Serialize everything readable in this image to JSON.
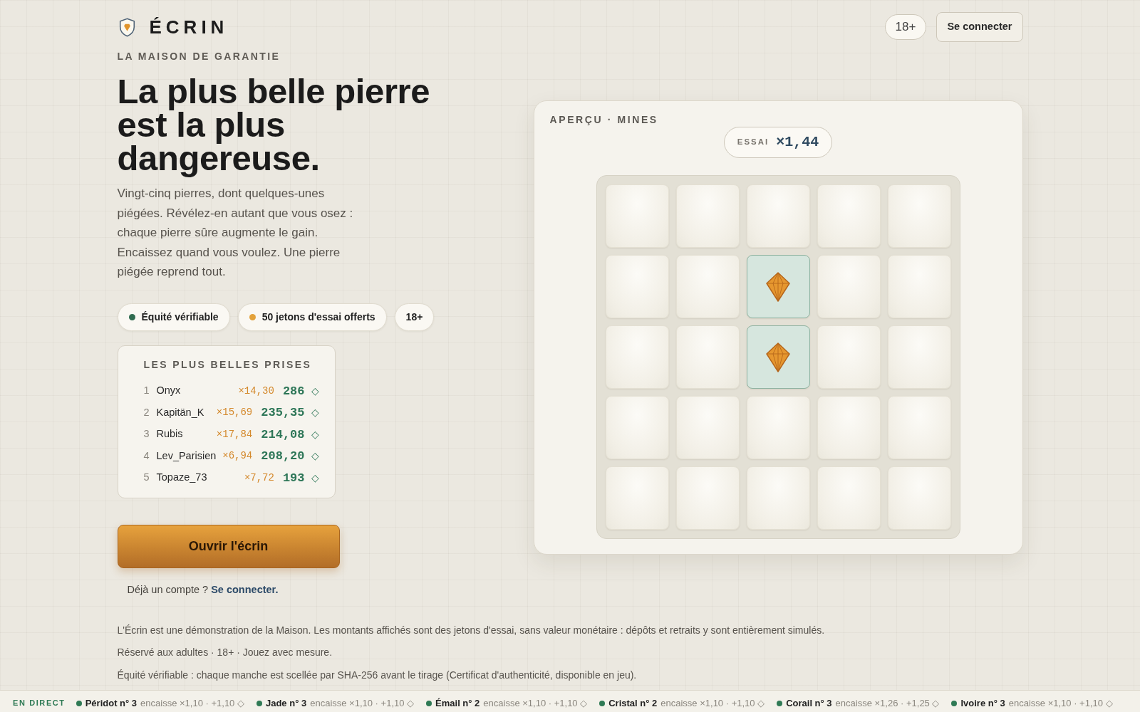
{
  "header": {
    "brand": "ÉCRIN",
    "age_badge": "18+",
    "login_button": "Se connecter"
  },
  "hero": {
    "tagline": "LA MAISON DE GARANTIE",
    "headline": "La plus belle pierre est la plus dangereuse.",
    "intro": "Vingt-cinq pierres, dont quelques-unes piégées. Révélez-en autant que vous osez : chaque pierre sûre augmente le gain. Encaissez quand vous voulez. Une pierre piégée reprend tout.",
    "chips": [
      {
        "label": "Équité vérifiable",
        "color": "#2f6b4f"
      },
      {
        "label": "50 jetons d'essai offerts",
        "color": "#e3a23b"
      },
      {
        "label": "18+"
      }
    ],
    "leaderboard": {
      "title": "LES PLUS BELLES PRISES",
      "rows": [
        {
          "rank": "1",
          "name": "Onyx",
          "multiplier": "×14,30",
          "amount": "286",
          "unit": "◇"
        },
        {
          "rank": "2",
          "name": "Kapitän_K",
          "multiplier": "×15,69",
          "amount": "235,35",
          "unit": "◇"
        },
        {
          "rank": "3",
          "name": "Rubis",
          "multiplier": "×17,84",
          "amount": "214,08",
          "unit": "◇"
        },
        {
          "rank": "4",
          "name": "Lev_Parisien",
          "multiplier": "×6,94",
          "amount": "208,20",
          "unit": "◇"
        },
        {
          "rank": "5",
          "name": "Topaze_73",
          "multiplier": "×7,72",
          "amount": "193",
          "unit": "◇"
        }
      ]
    },
    "cta_button": "Ouvrir l'écrin",
    "login_prompt": {
      "text": "Déjà un compte ?",
      "link": "Se connecter."
    }
  },
  "preview": {
    "title": "APERÇU · MINES",
    "multiplier": {
      "label": "ESSAI",
      "value": "×1,44"
    },
    "tiles": [
      {
        "revealed": false
      },
      {
        "revealed": false
      },
      {
        "revealed": false
      },
      {
        "revealed": false
      },
      {
        "revealed": false
      },
      {
        "revealed": false
      },
      {
        "revealed": false
      },
      {
        "revealed": true
      },
      {
        "revealed": false
      },
      {
        "revealed": false
      },
      {
        "revealed": false
      },
      {
        "revealed": false
      },
      {
        "revealed": true
      },
      {
        "revealed": false
      },
      {
        "revealed": false
      },
      {
        "revealed": false
      },
      {
        "revealed": false
      },
      {
        "revealed": false
      },
      {
        "revealed": false
      },
      {
        "revealed": false
      },
      {
        "revealed": false
      },
      {
        "revealed": false
      },
      {
        "revealed": false
      },
      {
        "revealed": false
      },
      {
        "revealed": false
      }
    ]
  },
  "notes": [
    "L'Écrin est une démonstration de la Maison. Les montants affichés sont des jetons d'essai, sans valeur monétaire : dépôts et retraits y sont entièrement simulés.",
    "Réservé aux adultes · 18+ · Jouez avec mesure.",
    "Équité vérifiable : chaque manche est scellée par SHA-256 avant le tirage (Certificat d'authenticité, disponible en jeu)."
  ],
  "ticker": {
    "label": "EN DIRECT",
    "items": [
      {
        "name": "Péridot n° 3",
        "detail": "encaisse ×1,10 · +1,10 ◇"
      },
      {
        "name": "Jade n° 3",
        "detail": "encaisse ×1,10 · +1,10 ◇"
      },
      {
        "name": "Émail n° 2",
        "detail": "encaisse ×1,10 · +1,10 ◇"
      },
      {
        "name": "Cristal n° 2",
        "detail": "encaisse ×1,10 · +1,10 ◇"
      },
      {
        "name": "Corail n° 3",
        "detail": "encaisse ×1,26 · +1,25 ◇"
      },
      {
        "name": "Ivoire n° 3",
        "detail": "encaisse ×1,10 · +1,10 ◇"
      }
    ]
  }
}
